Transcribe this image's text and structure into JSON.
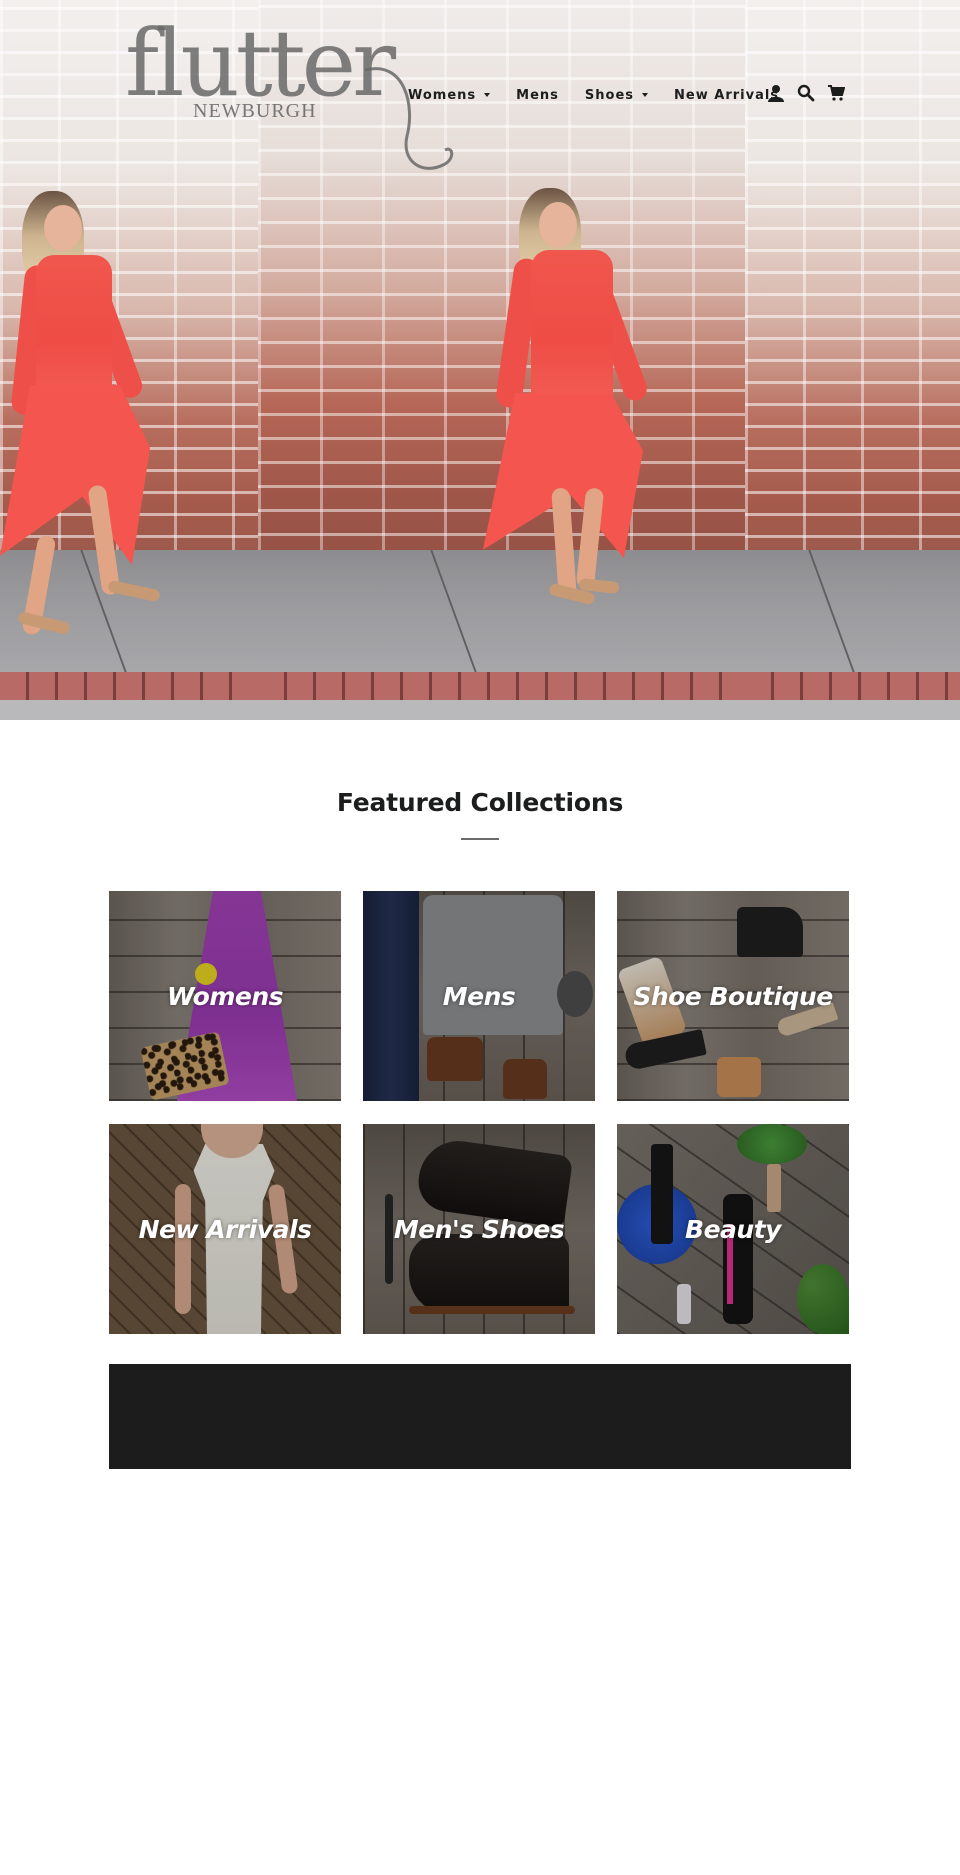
{
  "brand": {
    "logo_word": "flutter",
    "logo_sub": "NEWBURGH"
  },
  "nav": {
    "items": [
      {
        "label": "Womens",
        "has_dropdown": true
      },
      {
        "label": "Mens",
        "has_dropdown": false
      },
      {
        "label": "Shoes",
        "has_dropdown": true
      },
      {
        "label": "New Arrivals",
        "has_dropdown": false
      }
    ],
    "icons": [
      "account-icon",
      "search-icon",
      "cart-icon"
    ]
  },
  "featured": {
    "title": "Featured Collections",
    "collections": [
      {
        "label": "Womens"
      },
      {
        "label": "Mens"
      },
      {
        "label": "Shoe Boutique"
      },
      {
        "label": "New Arrivals"
      },
      {
        "label": "Men's Shoes"
      },
      {
        "label": "Beauty"
      }
    ]
  },
  "colors": {
    "text": "#1c1d1d",
    "dress": "#ee4c45",
    "banner": "#1c1c1c"
  }
}
